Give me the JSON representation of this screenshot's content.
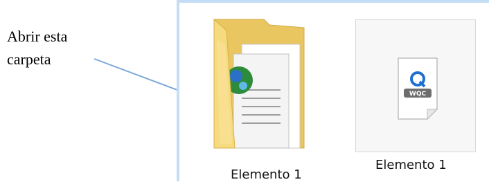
{
  "annotation": {
    "line1": "Abrir esta",
    "line2": "carpeta"
  },
  "items": [
    {
      "label": "Elemento 1",
      "icon": "folder-icon"
    },
    {
      "label": "Elemento 1",
      "icon": "wqc-file-icon",
      "badge_text": "WQC",
      "badge_letter": "Q"
    }
  ],
  "colors": {
    "folder": "#f3d579",
    "window_border": "#c4ddf5",
    "badge_blue": "#1e6fd1",
    "arrow": "#7aa7d9"
  }
}
